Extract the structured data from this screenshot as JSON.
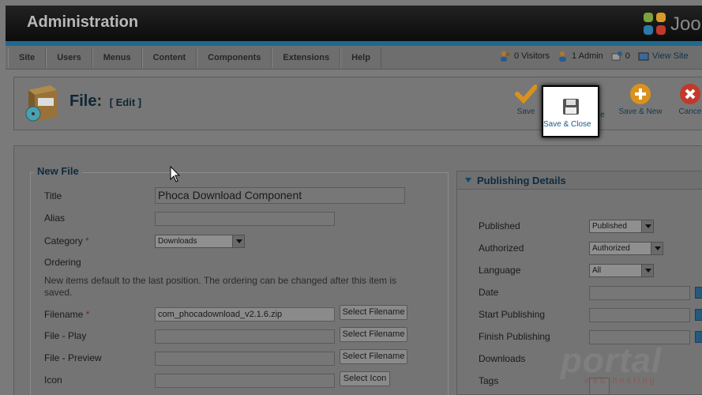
{
  "header": {
    "title": "Administration",
    "brand": "Joo"
  },
  "menu": {
    "items": [
      "Site",
      "Users",
      "Menus",
      "Content",
      "Components",
      "Extensions",
      "Help"
    ]
  },
  "status": {
    "visitors": "0 Visitors",
    "admin": "1 Admin",
    "messages": "0",
    "view_site": "View Site"
  },
  "page": {
    "title": "File:",
    "subtitle": "[ Edit ]"
  },
  "toolbar": {
    "save": "Save",
    "save_close": "Save & Close",
    "save_new": "Save & New",
    "cancel": "Cance",
    "hidden_suffix": "e"
  },
  "form": {
    "legend": "New File",
    "title_label": "Title",
    "title_value": "Phoca Download Component",
    "alias_label": "Alias",
    "alias_value": "",
    "category_label": "Category",
    "category_value": "Downloads",
    "ordering_label": "Ordering",
    "ordering_note": "New items default to the last position. The ordering can be changed after this item is saved.",
    "filename_label": "Filename",
    "filename_value": "com_phocadownload_v2.1.6.zip",
    "file_play_label": "File - Play",
    "file_preview_label": "File - Preview",
    "icon_label": "Icon",
    "required_mark": "*",
    "select_filename": "Select Filename",
    "select_icon": "Select Icon"
  },
  "publishing": {
    "heading": "Publishing Details",
    "published_label": "Published",
    "published_value": "Published",
    "authorized_label": "Authorized",
    "authorized_value": "Authorized",
    "language_label": "Language",
    "language_value": "All",
    "date_label": "Date",
    "start_label": "Start Publishing",
    "finish_label": "Finish Publishing",
    "downloads_label": "Downloads",
    "tags_label": "Tags"
  },
  "watermark": {
    "main": "portal",
    "sub": "web hosting"
  },
  "colors": {
    "accent_blue": "#1e6a8f",
    "save_orange": "#d9921c",
    "cancel_red": "#c0392b",
    "link": "#1a5a84"
  }
}
